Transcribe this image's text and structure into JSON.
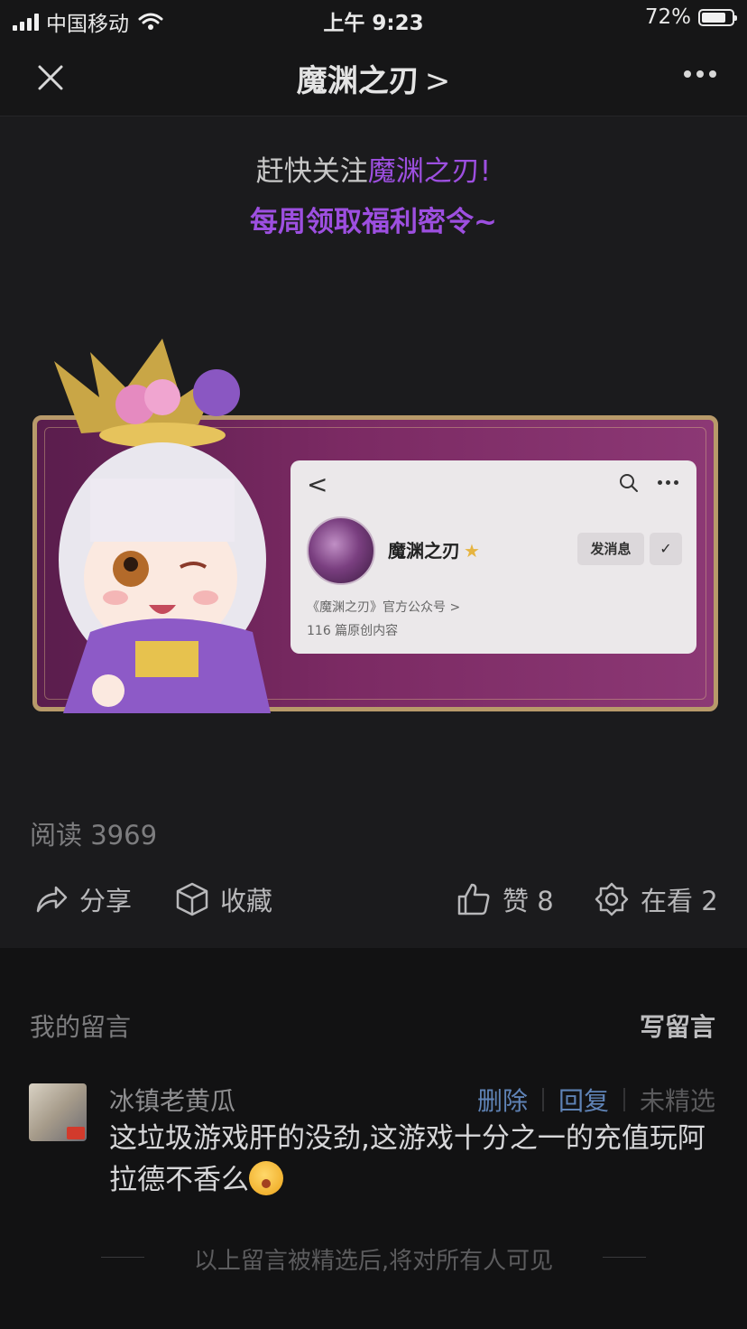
{
  "status_bar": {
    "carrier": "中国移动",
    "time": "上午 9:23",
    "battery": "72%",
    "battery_level": 0.72
  },
  "nav": {
    "title": "魔渊之刃",
    "title_chevron": ">",
    "close_icon": "close-icon",
    "more_icon": "more-icon"
  },
  "promo": {
    "line1_prefix": "赶快关注",
    "line1_highlight": "魔渊之刃!",
    "line2": "每周领取福利密令~",
    "accent_color": "#9d4fe0"
  },
  "banner_card": {
    "back": "<",
    "account_name": "魔渊之刃",
    "message_button": "发消息",
    "description": "《魔渊之刃》官方公众号",
    "description_chevron": ">",
    "article_count": "116 篇原创内容"
  },
  "stats": {
    "read_count": "阅读 3969"
  },
  "actions": {
    "share": "分享",
    "favorite": "收藏",
    "like": "赞 8",
    "watching": "在看 2"
  },
  "comments": {
    "header": "我的留言",
    "write": "写留言",
    "items": [
      {
        "user": "冰镇老黄瓜",
        "delete": "删除",
        "reply": "回复",
        "status": "未精选",
        "text": "这垃圾游戏肝的没劲,这游戏十分之一的充值玩阿拉德不香么"
      }
    ],
    "footer": "以上留言被精选后,将对所有人可见"
  }
}
